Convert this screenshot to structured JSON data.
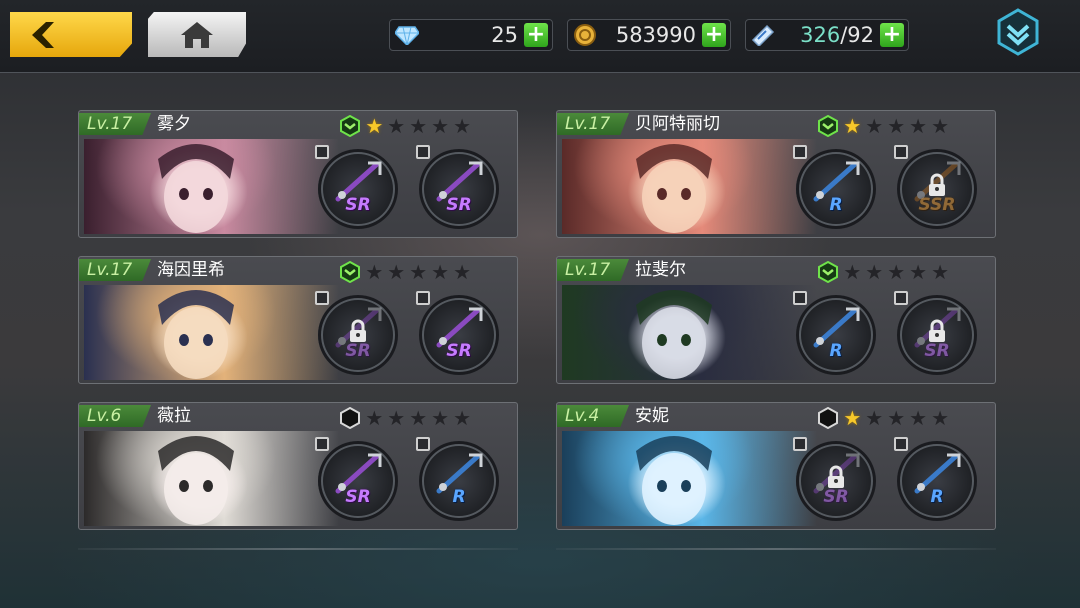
{
  "topbar": {
    "back_icon": "back-arrow-icon",
    "home_icon": "home-icon",
    "diamonds": {
      "icon": "diamond-icon",
      "value": "25"
    },
    "gold": {
      "icon": "gold-coin-icon",
      "value": "583990"
    },
    "stamina": {
      "icon": "stamina-ticket-icon",
      "current": "326",
      "separator": "/",
      "max": "92"
    },
    "menu_icon": "chevron-down-menu-icon"
  },
  "colors": {
    "accent_green": "#4b8a3a",
    "star_gold": "#f7c82a",
    "sr_purple": "#c67bff",
    "r_blue": "#5aa6ff",
    "ssr_orange": "#e39a3a"
  },
  "characters": [
    {
      "level": "Lv.17",
      "name": "雾夕",
      "rank_icon": "green-chevron-rank-icon",
      "stars_filled": 1,
      "stars_total": 5,
      "weapons": [
        {
          "rarity": "SR",
          "icon": "fan-weapon-icon",
          "locked": false
        },
        {
          "rarity": "SR",
          "icon": "spear-weapon-icon",
          "locked": false
        }
      ]
    },
    {
      "level": "Lv.17",
      "name": "贝阿特丽切",
      "rank_icon": "green-chevron-rank-icon",
      "stars_filled": 1,
      "stars_total": 5,
      "weapons": [
        {
          "rarity": "R",
          "icon": "sword-weapon-icon",
          "locked": false
        },
        {
          "rarity": "SSR",
          "icon": "crossbow-weapon-icon",
          "locked": true
        }
      ]
    },
    {
      "level": "Lv.17",
      "name": "海因里希",
      "rank_icon": "green-chevron-rank-icon",
      "stars_filled": 0,
      "stars_total": 5,
      "weapons": [
        {
          "rarity": "SR",
          "icon": "blade-weapon-icon",
          "locked": true
        },
        {
          "rarity": "SR",
          "icon": "crimson-sword-icon",
          "locked": false
        }
      ]
    },
    {
      "level": "Lv.17",
      "name": "拉斐尔",
      "rank_icon": "green-chevron-rank-icon",
      "stars_filled": 0,
      "stars_total": 5,
      "weapons": [
        {
          "rarity": "R",
          "icon": "flower-staff-icon",
          "locked": false
        },
        {
          "rarity": "SR",
          "icon": "wreath-weapon-icon",
          "locked": true
        }
      ]
    },
    {
      "level": "Lv.6",
      "name": "薇拉",
      "rank_icon": "hexagon-rank-icon",
      "stars_filled": 0,
      "stars_total": 5,
      "weapons": [
        {
          "rarity": "SR",
          "icon": "death-cannon-icon",
          "locked": false
        },
        {
          "rarity": "R",
          "icon": "blaster-weapon-icon",
          "locked": false
        }
      ]
    },
    {
      "level": "Lv.4",
      "name": "安妮",
      "rank_icon": "hexagon-rank-icon",
      "stars_filled": 1,
      "stars_total": 5,
      "weapons": [
        {
          "rarity": "SR",
          "icon": "launcher-weapon-icon",
          "locked": true
        },
        {
          "rarity": "R",
          "icon": "magic-wand-icon",
          "locked": false
        }
      ]
    }
  ]
}
